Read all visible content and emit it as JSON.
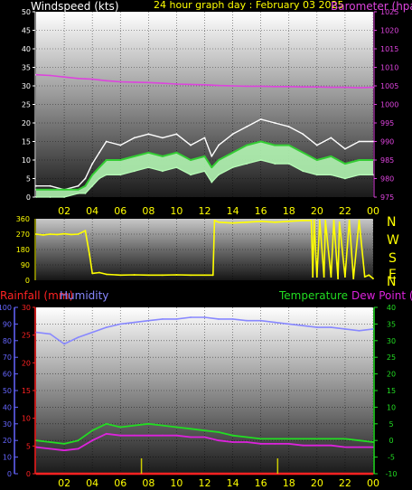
{
  "header": {
    "title": "24 hour graph day : February 03 2025",
    "wind_label": "Windspeed (kts)",
    "baro_label": "Barometer (hpa)"
  },
  "colors": {
    "wind_max": "#ffffff",
    "wind_avg": "#33cc33",
    "wind_light": "#b8ffb8",
    "baro": "#dd44dd",
    "direction": "#ffff00",
    "rain": "#ff2222",
    "humidity": "#8888ff",
    "temperature": "#22dd22",
    "dew": "#dd22dd",
    "axis_blue": "#6666ff",
    "axis_red": "#ff2222",
    "axis_green": "#22dd22"
  },
  "x_ticks": [
    "02",
    "04",
    "06",
    "08",
    "10",
    "12",
    "14",
    "16",
    "18",
    "20",
    "22",
    "00"
  ],
  "wind_panel": {
    "wind_ticks": [
      "0",
      "5",
      "10",
      "15",
      "20",
      "25",
      "30",
      "35",
      "40",
      "45",
      "50"
    ],
    "baro_ticks": [
      "975",
      "980",
      "985",
      "990",
      "995",
      "1000",
      "1005",
      "1010",
      "1015",
      "1020",
      "1025"
    ]
  },
  "dir_panel": {
    "ticks": [
      "0",
      "90",
      "180",
      "270",
      "360"
    ],
    "compass": [
      "N",
      "W",
      "S",
      "E",
      "N"
    ]
  },
  "climate_panel": {
    "rain_label": "Rainfall (mm)",
    "hum_label": "Humidity",
    "temp_label": "Temperature",
    "dew_label": "Dew Point (hpa)",
    "hum_ticks": [
      "0",
      "10",
      "20",
      "30",
      "40",
      "50",
      "60",
      "70",
      "80",
      "90",
      "100"
    ],
    "rain_ticks": [
      "0",
      "5",
      "10",
      "15",
      "20",
      "25",
      "30"
    ],
    "temp_ticks": [
      "-10",
      "-5",
      "0",
      "5",
      "10",
      "15",
      "20",
      "25",
      "30",
      "35",
      "40"
    ]
  },
  "chart_data": [
    {
      "type": "line",
      "panel": "wind",
      "x_hours": [
        0,
        1,
        2,
        3,
        3.5,
        4,
        4.5,
        5,
        6,
        7,
        8,
        9,
        10,
        11,
        12,
        12.5,
        13,
        14,
        15,
        16,
        17,
        18,
        19,
        20,
        21,
        22,
        23,
        24
      ],
      "series": [
        {
          "name": "Windspeed (kts)",
          "role": "gust",
          "values": [
            3,
            3,
            2,
            3,
            5,
            9,
            12,
            15,
            14,
            16,
            17,
            16,
            17,
            14,
            16,
            11,
            14,
            17,
            19,
            21,
            20,
            19,
            17,
            14,
            16,
            13,
            15,
            15
          ]
        },
        {
          "name": "Windspeed (kts)",
          "role": "average",
          "values": [
            2,
            2,
            2,
            2,
            3,
            6,
            8,
            10,
            10,
            11,
            12,
            11,
            12,
            10,
            11,
            8,
            10,
            12,
            14,
            15,
            14,
            14,
            12,
            10,
            11,
            9,
            10,
            10
          ]
        },
        {
          "name": "Windspeed (kts)",
          "role": "minimum",
          "values": [
            0,
            0,
            0,
            1,
            1,
            3,
            5,
            6,
            6,
            7,
            8,
            7,
            8,
            6,
            7,
            4,
            6,
            8,
            9,
            10,
            9,
            9,
            7,
            6,
            6,
            5,
            6,
            6
          ]
        },
        {
          "name": "Barometer (hpa)",
          "axis": "right",
          "values": [
            1008,
            1007.8,
            1007.4,
            1007,
            1006.9,
            1006.8,
            1006.6,
            1006.4,
            1006.1,
            1006.0,
            1005.9,
            1005.7,
            1005.5,
            1005.4,
            1005.3,
            1005.2,
            1005.1,
            1005.0,
            1004.9,
            1004.9,
            1004.8,
            1004.8,
            1004.7,
            1004.7,
            1004.6,
            1004.6,
            1004.5,
            1004.6
          ]
        }
      ],
      "ylim": [
        0,
        50
      ],
      "y2lim": [
        975,
        1025
      ],
      "xlim": [
        0,
        24
      ]
    },
    {
      "type": "line",
      "panel": "direction",
      "x_hours": [
        0,
        0.5,
        1,
        1.5,
        2,
        2.5,
        3,
        3.5,
        3.8,
        4,
        4.5,
        5,
        6,
        7,
        8,
        9,
        10,
        11,
        12,
        12.6,
        12.7,
        13,
        14,
        15,
        16,
        17,
        18,
        19,
        19.6,
        19.7,
        19.8,
        20,
        20.2,
        20.5,
        20.6,
        21,
        21.2,
        21.5,
        21.6,
        22,
        22.3,
        22.6,
        23,
        23.4,
        23.7,
        24
      ],
      "series": [
        {
          "name": "Direction",
          "values": [
            270,
            265,
            270,
            268,
            272,
            268,
            270,
            290,
            150,
            40,
            45,
            35,
            30,
            32,
            30,
            30,
            32,
            30,
            30,
            30,
            350,
            340,
            335,
            340,
            345,
            340,
            345,
            350,
            350,
            20,
            350,
            20,
            350,
            20,
            350,
            20,
            350,
            10,
            340,
            20,
            350,
            10,
            350,
            20,
            30,
            10
          ]
        }
      ],
      "ylim": [
        0,
        360
      ],
      "xlim": [
        0,
        24
      ]
    },
    {
      "type": "line",
      "panel": "climate",
      "x_hours": [
        0,
        1,
        2,
        3,
        4,
        5,
        6,
        7,
        8,
        9,
        10,
        11,
        12,
        13,
        14,
        15,
        16,
        17,
        18,
        19,
        20,
        21,
        22,
        23,
        24
      ],
      "series": [
        {
          "name": "Humidity",
          "axis": "left",
          "values": [
            85,
            84,
            78,
            82,
            85,
            88,
            90,
            91,
            92,
            93,
            93,
            94,
            94,
            93,
            93,
            92,
            92,
            91,
            90,
            89,
            88,
            88,
            87,
            86,
            87
          ]
        },
        {
          "name": "Temperature",
          "axis": "right",
          "values": [
            0,
            -0.5,
            -1,
            0,
            3,
            5,
            4,
            4.5,
            5,
            4.5,
            4,
            3.5,
            3,
            2.5,
            1.5,
            1,
            0.5,
            0.5,
            0.5,
            0.5,
            0.5,
            0.5,
            0.5,
            0,
            -0.5
          ]
        },
        {
          "name": "Dew Point (hpa)",
          "axis": "right",
          "values": [
            -2,
            -2.5,
            -3,
            -2.5,
            0,
            2,
            1.5,
            1.5,
            1.5,
            1.5,
            1.5,
            1,
            1,
            0,
            -0.5,
            -0.5,
            -1,
            -1,
            -1,
            -1.5,
            -1.5,
            -1.5,
            -2,
            -2,
            -2
          ]
        },
        {
          "name": "Rainfall (mm)",
          "axis": "rain",
          "values": [
            0,
            0,
            0,
            0,
            0,
            0,
            0,
            0,
            0,
            0,
            0,
            0,
            0,
            0,
            0,
            0,
            0,
            0,
            0,
            0,
            0,
            0,
            0,
            0,
            0
          ]
        }
      ],
      "rain_marks_hours": [
        7.5,
        17.2
      ],
      "ylim": [
        0,
        100
      ],
      "y_rain_lim": [
        0,
        30
      ],
      "y_temp_lim": [
        -10,
        40
      ],
      "xlim": [
        0,
        24
      ]
    }
  ]
}
